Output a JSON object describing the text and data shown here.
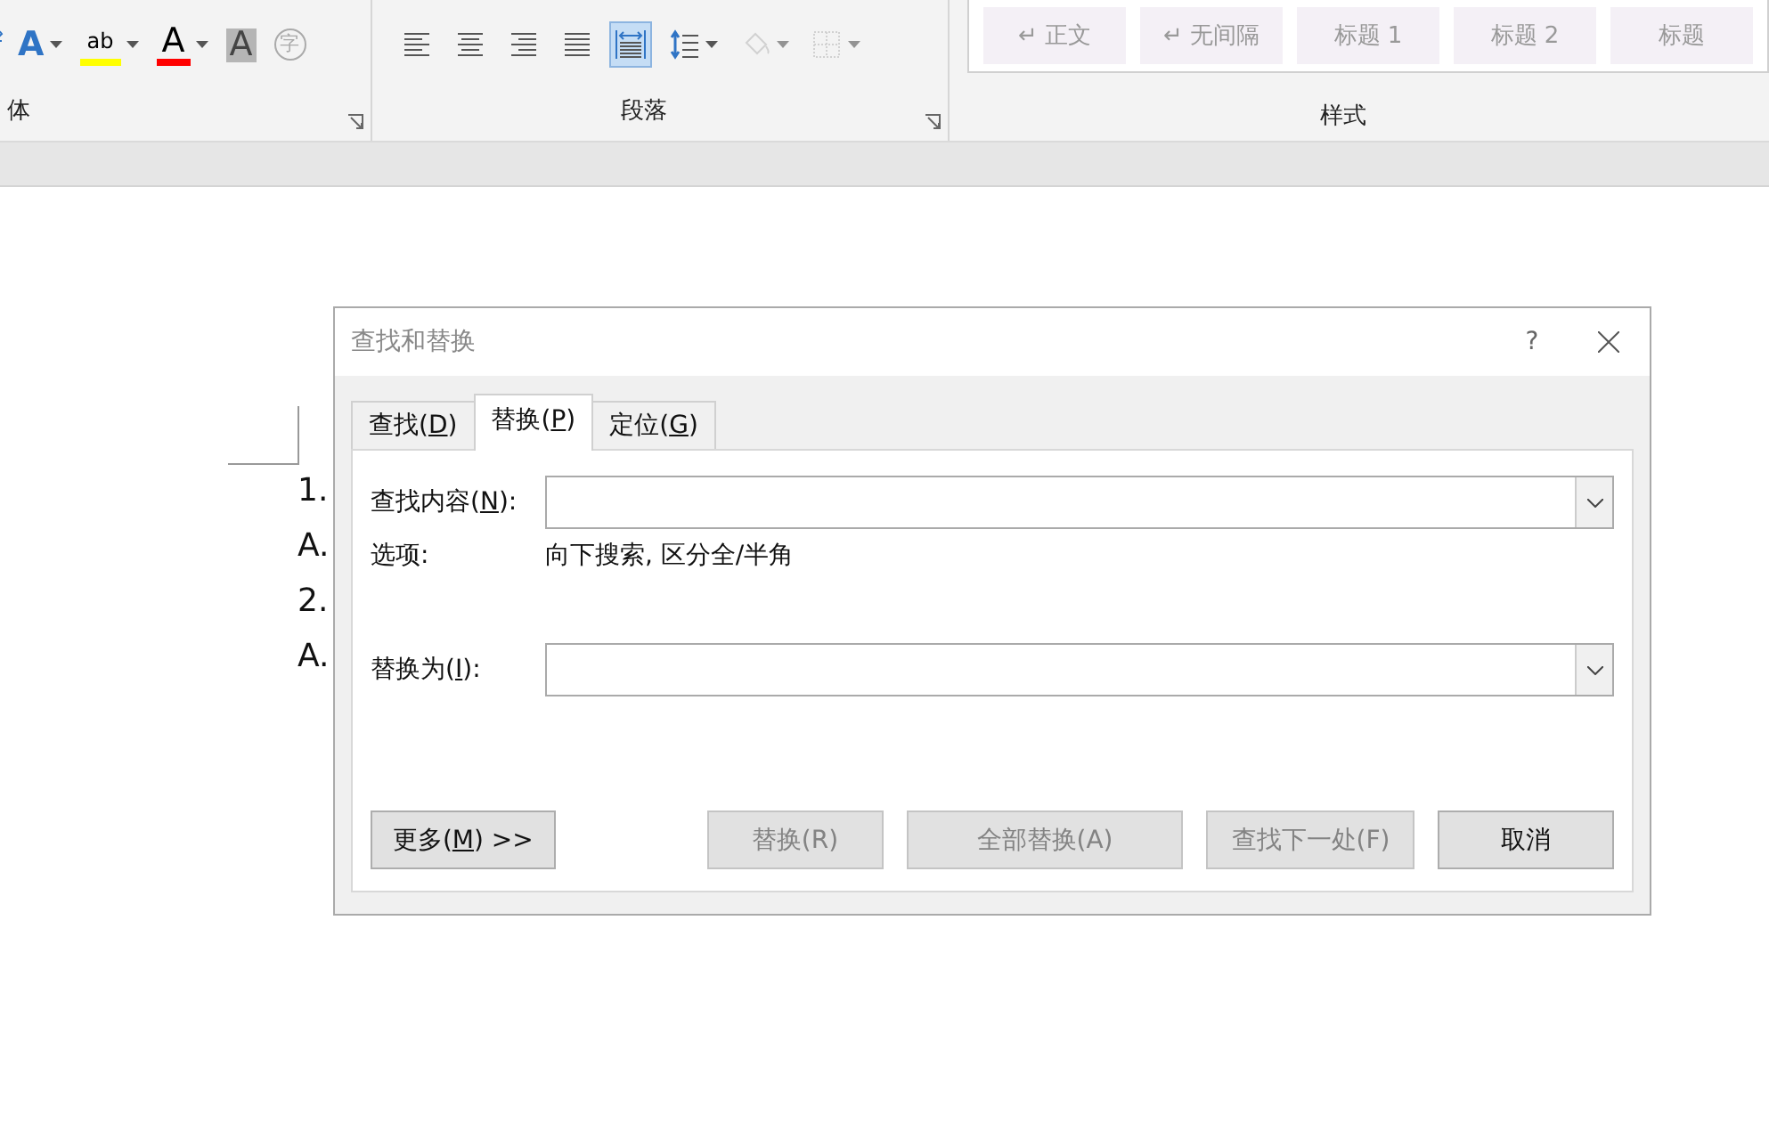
{
  "ribbon": {
    "font_group": {
      "label": "体",
      "tools": [
        {
          "kind": "superscript"
        },
        {
          "kind": "text-effect",
          "glyph": "A",
          "dropdown": true
        },
        {
          "kind": "highlight",
          "glyph": "ab",
          "dropdown": true,
          "color": "#ffff00"
        },
        {
          "kind": "font-color",
          "glyph": "A",
          "dropdown": true,
          "color": "#ff0000"
        },
        {
          "kind": "shading",
          "glyph": "A",
          "dropdown": false
        },
        {
          "kind": "enclose",
          "glyph": "字",
          "dropdown": false
        }
      ]
    },
    "paragraph_group": {
      "label": "段落",
      "tools": [
        {
          "kind": "align-left",
          "selected": false,
          "disabled": false
        },
        {
          "kind": "align-center",
          "selected": false,
          "disabled": false
        },
        {
          "kind": "align-right",
          "selected": false,
          "disabled": false
        },
        {
          "kind": "justify",
          "selected": false,
          "disabled": false
        },
        {
          "kind": "distributed",
          "selected": true,
          "disabled": false
        },
        {
          "kind": "line-spacing",
          "selected": false,
          "disabled": false
        },
        {
          "kind": "shading",
          "selected": false,
          "disabled": true
        },
        {
          "kind": "borders",
          "selected": false,
          "disabled": true
        }
      ]
    },
    "styles_group": {
      "label": "样式",
      "styles": [
        {
          "name": "正文",
          "mark": "↵"
        },
        {
          "name": "无间隔",
          "mark": "↵"
        },
        {
          "name": "标题 1"
        },
        {
          "name": "标题 2"
        },
        {
          "name": "标题"
        }
      ]
    }
  },
  "document": {
    "lines": [
      "1.",
      "A.",
      "2.",
      "A."
    ]
  },
  "dialog": {
    "title": "查找和替换",
    "help": "?",
    "tabs": [
      {
        "label": "查找(",
        "key": "D",
        "suffix": ")",
        "selected": false
      },
      {
        "label": "替换(",
        "key": "P",
        "suffix": ")",
        "selected": true
      },
      {
        "label": "定位(",
        "key": "G",
        "suffix": ")",
        "selected": false
      }
    ],
    "find_label": {
      "label": "查找内容(",
      "key": "N",
      "suffix": "):"
    },
    "options_label": "选项:",
    "options_value": "向下搜索, 区分全/半角",
    "replace_label": {
      "label": "替换为(",
      "key": "I",
      "suffix": "):"
    },
    "buttons": [
      {
        "label": "更多(",
        "key": "M",
        "suffix": ") >>",
        "disabled": false
      },
      {
        "label": "替换(R)",
        "disabled": true
      },
      {
        "label": "全部替换(A)",
        "disabled": true
      },
      {
        "label": "查找下一处(F)",
        "disabled": true
      },
      {
        "label": "取消",
        "disabled": false
      }
    ]
  }
}
